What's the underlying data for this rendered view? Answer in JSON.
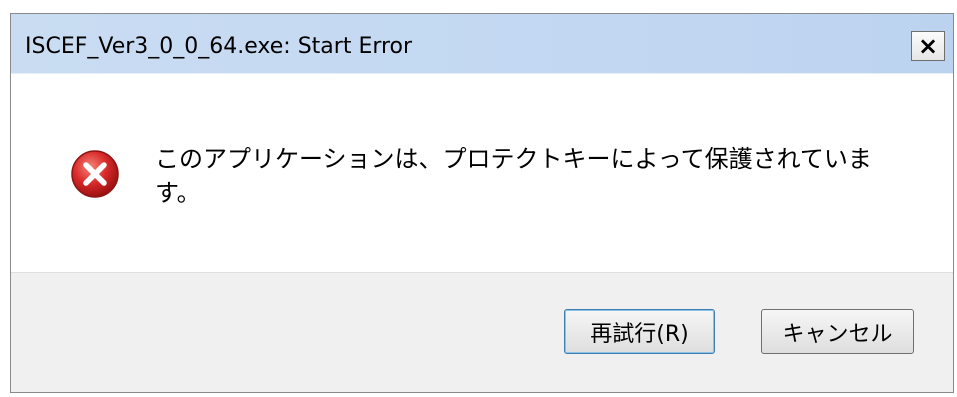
{
  "window": {
    "title": "ISCEF_Ver3_0_0_64.exe: Start Error",
    "close_label": "×"
  },
  "message": {
    "icon": "error-icon",
    "text": "このアプリケーションは、プロテクトキーによって保護されています。"
  },
  "buttons": {
    "retry_label": "再試行(R)",
    "cancel_label": "キャンセル"
  },
  "colors": {
    "titlebar": "#c3d8f2",
    "footer": "#f0f0f0",
    "error_red": "#d92a2a"
  }
}
